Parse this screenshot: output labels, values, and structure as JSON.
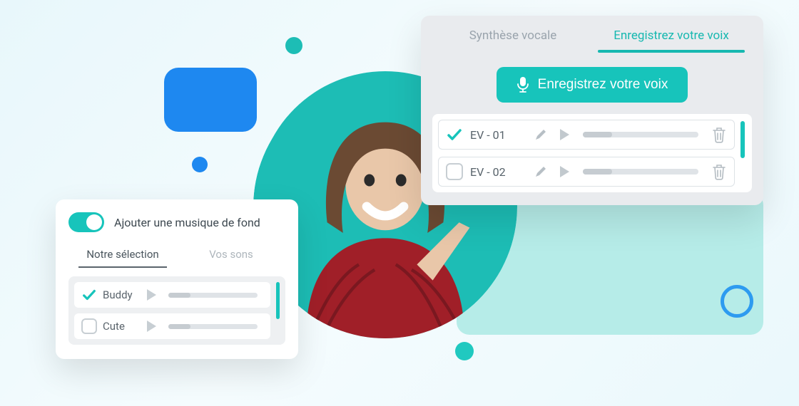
{
  "colors": {
    "accent": "#17c4bb",
    "blue": "#1e88f0"
  },
  "voice_card": {
    "tabs": {
      "tts": "Synthèse vocale",
      "record": "Enregistrez votre voix",
      "active": "record"
    },
    "record_button": "Enregistrez votre voix",
    "recordings": [
      {
        "label": "EV - 01",
        "checked": true
      },
      {
        "label": "EV - 02",
        "checked": false
      }
    ]
  },
  "music_card": {
    "toggle": {
      "on": true,
      "label": "Ajouter une musique de fond"
    },
    "tabs": {
      "ours": "Notre sélection",
      "yours": "Vos sons",
      "active": "ours"
    },
    "tracks": [
      {
        "label": "Buddy",
        "checked": true
      },
      {
        "label": "Cute",
        "checked": false
      }
    ]
  }
}
